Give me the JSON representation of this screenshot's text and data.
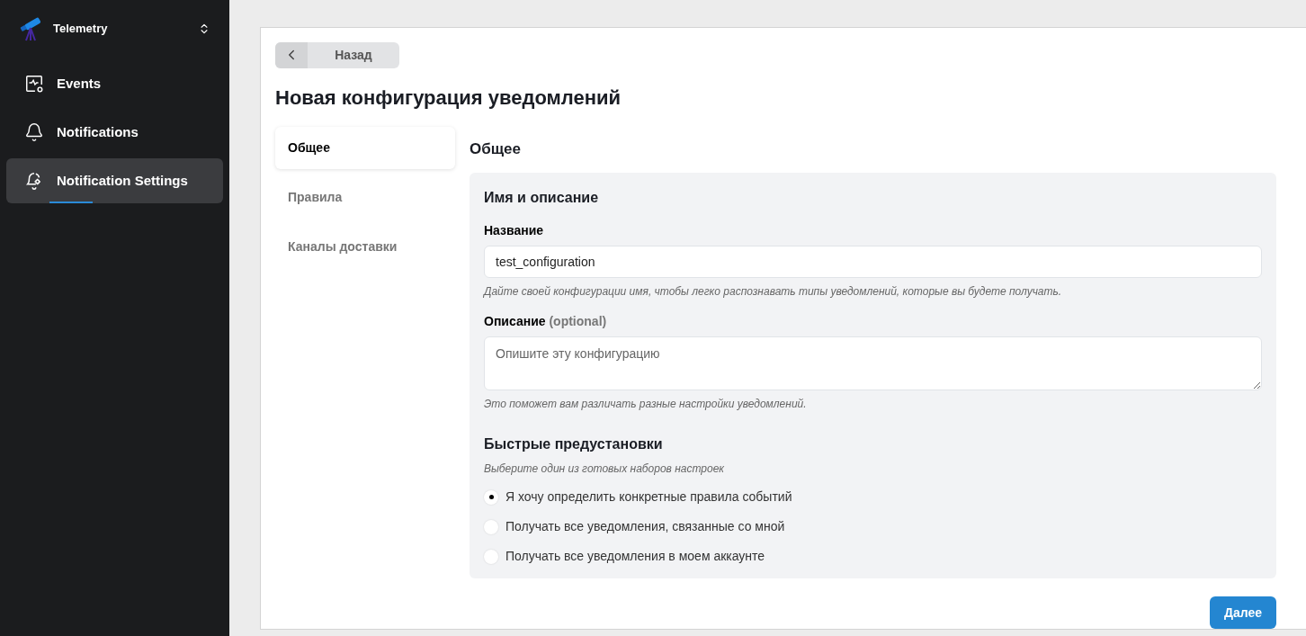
{
  "workspace": {
    "name": "Telemetry"
  },
  "sidebar": {
    "items": [
      {
        "label": "Events",
        "kind": "events",
        "selected": false
      },
      {
        "label": "Notifications",
        "kind": "bell",
        "selected": false
      },
      {
        "label": "Notification Settings",
        "kind": "bell-gear",
        "selected": true
      }
    ]
  },
  "back_button": {
    "label": "Назад"
  },
  "page_title": "Новая конфигурация уведомлений",
  "steps": [
    {
      "label": "Общее",
      "selected": true
    },
    {
      "label": "Правила",
      "selected": false
    },
    {
      "label": "Каналы доставки",
      "selected": false
    }
  ],
  "section_title": "Общее",
  "name_section": {
    "title": "Имя и описание",
    "name_field": {
      "label": "Название",
      "value": "test_configuration",
      "hint": "Дайте своей конфигурации имя, чтобы легко распознавать типы уведомлений, которые вы будете получать."
    },
    "description_field": {
      "label": "Описание",
      "optional": "(optional)",
      "placeholder": "Опишите эту конфигурацию",
      "hint": "Это поможет вам различать разные настройки уведомлений."
    }
  },
  "presets": {
    "title": "Быстрые предустановки",
    "subtitle": "Выберите один из готовых наборов настроек",
    "options": [
      {
        "label": "Я хочу определить конкретные правила событий",
        "selected": true
      },
      {
        "label": "Получать все уведомления, связанные со мной",
        "selected": false
      },
      {
        "label": "Получать все уведомления в моем аккаунте",
        "selected": false
      }
    ]
  },
  "next_button": {
    "label": "Далее"
  }
}
